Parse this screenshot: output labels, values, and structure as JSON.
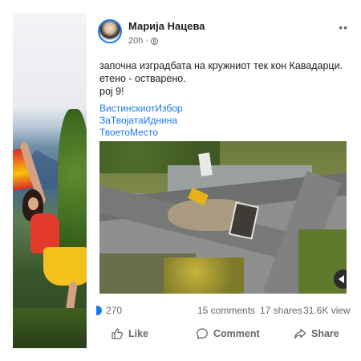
{
  "post": {
    "author": "Марија Нацева",
    "time": "20h",
    "time_sep": "·",
    "more": "••",
    "text_lines": [
      "започна изградбата на кружниот тек кон Кавадарци.",
      "етено - остварено.",
      "рој 9!"
    ],
    "hashtags": [
      "ВистинскиотИзбор",
      "ЗаТвојатаИднина",
      "ТвоетоМесто"
    ],
    "reactions_count": "270",
    "comments": "15 comments",
    "shares": "17 shares",
    "views": "31.6K view"
  },
  "actions": {
    "like": "Like",
    "comment": "Comment",
    "share": "Share"
  },
  "icons": {
    "privacy": "globe-icon",
    "like": "thumbs-up-icon",
    "comment": "speech-bubble-icon",
    "share": "share-arrow-icon",
    "more": "more-options-icon",
    "reaction": "like-reaction-icon",
    "video": "play-icon"
  },
  "colors": {
    "accent": "#1877f2",
    "secondary_text": "#65676b",
    "primary_text": "#1c1e21"
  }
}
